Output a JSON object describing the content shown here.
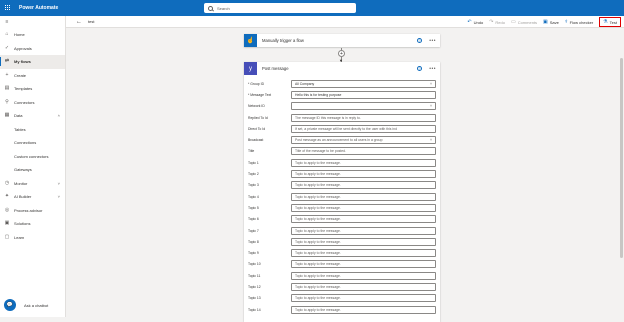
{
  "header": {
    "app_title": "Power Automate",
    "search_placeholder": "Search"
  },
  "sidebar": {
    "items": [
      {
        "label": "Home",
        "icon": "home-icon",
        "glyph": "⌂"
      },
      {
        "label": "Approvals",
        "icon": "approvals-icon",
        "glyph": "✓"
      },
      {
        "label": "My flows",
        "icon": "flows-icon",
        "glyph": "⇄",
        "active": true
      },
      {
        "label": "Create",
        "icon": "create-icon",
        "glyph": "+"
      },
      {
        "label": "Templates",
        "icon": "templates-icon",
        "glyph": "▤"
      },
      {
        "label": "Connectors",
        "icon": "connectors-icon",
        "glyph": "⚲"
      },
      {
        "label": "Data",
        "icon": "data-icon",
        "glyph": "▦",
        "chevron": "˄"
      },
      {
        "label": "Tables",
        "sub": true
      },
      {
        "label": "Connections",
        "sub": true
      },
      {
        "label": "Custom connectors",
        "sub": true
      },
      {
        "label": "Gateways",
        "sub": true
      },
      {
        "label": "Monitor",
        "icon": "monitor-icon",
        "glyph": "◷",
        "chevron": "˅"
      },
      {
        "label": "AI Builder",
        "icon": "ai-builder-icon",
        "glyph": "✦",
        "chevron": "˅"
      },
      {
        "label": "Process advisor",
        "icon": "process-advisor-icon",
        "glyph": "◎"
      },
      {
        "label": "Solutions",
        "icon": "solutions-icon",
        "glyph": "▣"
      },
      {
        "label": "Learn",
        "icon": "learn-icon",
        "glyph": "▢"
      }
    ],
    "chatbot_label": "Ask a chatbot"
  },
  "commandbar": {
    "flow_name": "test",
    "undo": "Undo",
    "redo": "Redo",
    "comments": "Comments",
    "save": "Save",
    "flow_checker": "Flow checker",
    "test": "Test"
  },
  "trigger_card": {
    "title": "Manually trigger a flow",
    "color": "#0f6cbd"
  },
  "action_card": {
    "title": "Post message",
    "color": "#464eb8",
    "fields": [
      {
        "label": "* Group ID",
        "value": "All Company",
        "filled": true,
        "dropdown": true
      },
      {
        "label": "* Message Text",
        "value": "Hello this is for testing purpose",
        "filled": true
      },
      {
        "label": "Network ID",
        "value": "",
        "dropdown": true
      },
      {
        "label": "Replied To Id",
        "value": "The message ID this message is in reply to."
      },
      {
        "label": "Direct To Id",
        "value": "If set, a private message will be sent directly to the user with this ind"
      },
      {
        "label": "Broadcast",
        "value": "Post message as an announcement to all users in a group",
        "dropdown": true
      },
      {
        "label": "Title",
        "value": "Title of the message to be posted."
      },
      {
        "label": "Topic 1",
        "value": "Topic to apply to the message."
      },
      {
        "label": "Topic 2",
        "value": "Topic to apply to the message."
      },
      {
        "label": "Topic 3",
        "value": "Topic to apply to the message."
      },
      {
        "label": "Topic 4",
        "value": "Topic to apply to the message."
      },
      {
        "label": "Topic 5",
        "value": "Topic to apply to the message."
      },
      {
        "label": "Topic 6",
        "value": "Topic to apply to the message."
      },
      {
        "label": "Topic 7",
        "value": "Topic to apply to the message."
      },
      {
        "label": "Topic 8",
        "value": "Topic to apply to the message."
      },
      {
        "label": "Topic 9",
        "value": "Topic to apply to the message."
      },
      {
        "label": "Topic 10",
        "value": "Topic to apply to the message."
      },
      {
        "label": "Topic 11",
        "value": "Topic to apply to the message."
      },
      {
        "label": "Topic 12",
        "value": "Topic to apply to the message."
      },
      {
        "label": "Topic 13",
        "value": "Topic to apply to the message."
      },
      {
        "label": "Topic 14",
        "value": "Topic to apply to the message."
      }
    ]
  }
}
